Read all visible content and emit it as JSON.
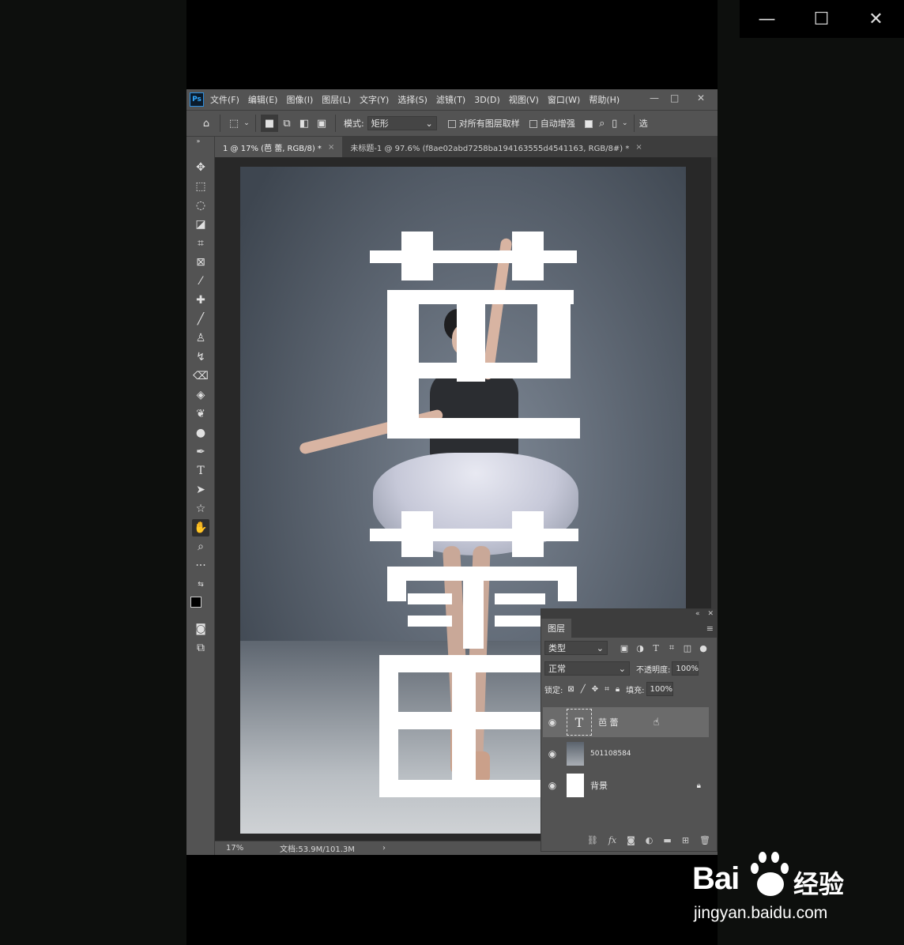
{
  "window_controls": {
    "minimize": "—",
    "maximize": "☐",
    "close": "✕"
  },
  "ps": {
    "logo": "Ps",
    "menu": [
      "文件(F)",
      "编辑(E)",
      "图像(I)",
      "图层(L)",
      "文字(Y)",
      "选择(S)",
      "滤镜(T)",
      "3D(D)",
      "视图(V)",
      "窗口(W)",
      "帮助(H)"
    ],
    "winbtns": {
      "min": "—",
      "max": "□",
      "close": "✕"
    },
    "options": {
      "mode_label": "模式:",
      "mode_value": "矩形",
      "sample_all": "对所有图层取样",
      "auto_enhance": "自动增强",
      "trailing": "选"
    },
    "tabs": [
      {
        "label": "1 @ 17% (芭 蕾, RGB/8) *",
        "close": "×"
      },
      {
        "label": "未标题-1 @ 97.6% (f8ae02abd7258ba194163555d4541163, RGB/8#) *",
        "close": "×"
      }
    ],
    "status": {
      "zoom": "17%",
      "doc": "文档:53.9M/101.3M",
      "arrow": "›"
    }
  },
  "canvas_text": {
    "char1": "芭",
    "char2": "蕾"
  },
  "layers_panel": {
    "title": "图层",
    "filter_kind": "类型",
    "blend_mode": "正常",
    "opacity_label": "不透明度:",
    "opacity_value": "100%",
    "lock_label": "锁定:",
    "fill_label": "填充:",
    "fill_value": "100%",
    "layers": [
      {
        "name": "芭 蕾",
        "type": "text",
        "selected": true
      },
      {
        "name": "501108584",
        "type": "image",
        "selected": false
      },
      {
        "name": "背景",
        "type": "background",
        "selected": false
      }
    ]
  },
  "watermark": {
    "brand": "Bai",
    "brand_cn": "经验",
    "url": "jingyan.baidu.com"
  },
  "colors": {
    "ps_panel": "#535353",
    "ps_dark": "#3d3d3d",
    "canvas": "#282828"
  }
}
